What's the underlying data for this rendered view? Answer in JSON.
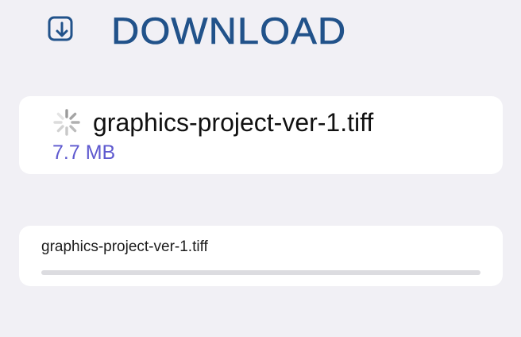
{
  "header": {
    "icon": "download-icon",
    "title": "DOWNLOAD"
  },
  "download_item": {
    "status_icon": "loading-spinner-icon",
    "file_name": "graphics-project-ver-1.tiff",
    "file_size": "7.7 MB"
  },
  "progress_item": {
    "file_name": "graphics-project-ver-1.tiff",
    "progress": 0
  },
  "colors": {
    "background": "#f1f0f5",
    "title": "#21528a",
    "accent": "#5e59cf",
    "card": "#ffffff",
    "track": "#dcdce0"
  }
}
